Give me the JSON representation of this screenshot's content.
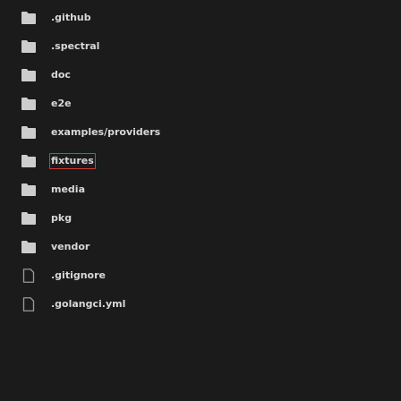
{
  "explorer": {
    "items": [
      {
        "name": ".github",
        "kind": "folder"
      },
      {
        "name": ".spectral",
        "kind": "folder"
      },
      {
        "name": "doc",
        "kind": "folder"
      },
      {
        "name": "e2e",
        "kind": "folder"
      },
      {
        "name": "examples/providers",
        "kind": "folder"
      },
      {
        "name": "fixtures",
        "kind": "folder",
        "selected": true
      },
      {
        "name": "media",
        "kind": "folder"
      },
      {
        "name": "pkg",
        "kind": "folder"
      },
      {
        "name": "vendor",
        "kind": "folder"
      },
      {
        "name": ".gitignore",
        "kind": "file"
      },
      {
        "name": ".golangci.yml",
        "kind": "file"
      }
    ]
  },
  "colors": {
    "background": "#1b1b1b",
    "folder_icon": "#cdcdcd",
    "file_icon": "#9a9a9a",
    "text": "#d8d8d8",
    "selection_border": "#d43a3a"
  }
}
